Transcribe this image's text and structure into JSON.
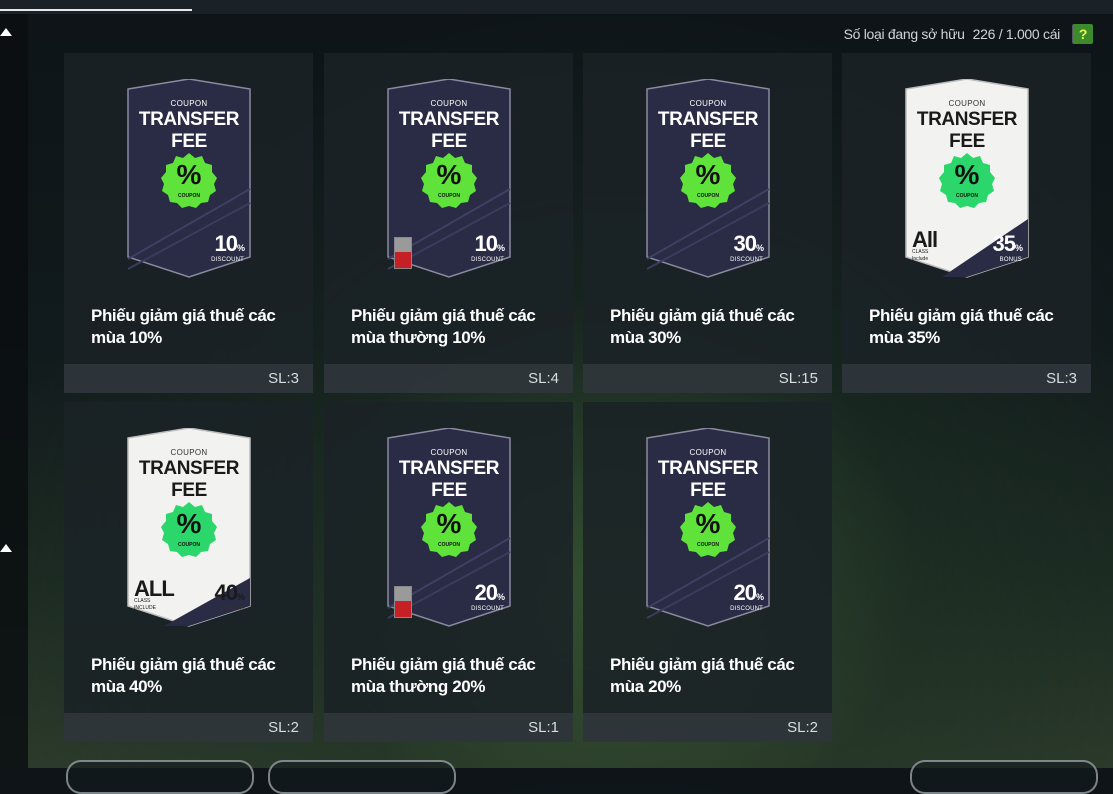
{
  "inventory": {
    "label": "Số loại đang sở hữu",
    "count": "226 / 1.000 cái",
    "help": "?"
  },
  "card_text": {
    "coupon": "COUPON",
    "title": "TRANSFER FEE",
    "pct": "%",
    "badge_coupon": "COUPON",
    "discount": "DISCOUNT",
    "bonus": "BONUS",
    "pct_sign": "%"
  },
  "colors": {
    "badge_green": "#5fe33a",
    "card_dark": "#2a2b44",
    "card_light": "#f2f2f0",
    "help_green": "#3c8a2c"
  },
  "items": [
    {
      "name": "Phiếu giảm giá thuế các mùa 10%",
      "qty": "SL:3",
      "value": "10",
      "sub": "DISCOUNT",
      "style": "dark",
      "locked": false
    },
    {
      "name": "Phiếu giảm giá thuế các mùa thường 10%",
      "qty": "SL:4",
      "value": "10",
      "sub": "DISCOUNT",
      "style": "dark",
      "locked": true
    },
    {
      "name": "Phiếu giảm giá thuế các mùa 30%",
      "qty": "SL:15",
      "value": "30",
      "sub": "DISCOUNT",
      "style": "dark",
      "locked": false
    },
    {
      "name": "Phiếu giảm giá thuế các mùa 35%",
      "qty": "SL:3",
      "value": "35",
      "sub": "BONUS",
      "style": "light",
      "all": "All",
      "all_sub": "CLASS\nInclude",
      "locked": false
    },
    {
      "name": "Phiếu giảm giá thuế các mùa 40%",
      "qty": "SL:2",
      "value": "40",
      "sub": "BONUS",
      "style": "light",
      "all": "ALL",
      "all_sub": "CLASS\nINCLUDE",
      "locked": false
    },
    {
      "name": "Phiếu giảm giá thuế các mùa thường 20%",
      "qty": "SL:1",
      "value": "20",
      "sub": "DISCOUNT",
      "style": "dark",
      "locked": true
    },
    {
      "name": "Phiếu giảm giá thuế các mùa 20%",
      "qty": "SL:2",
      "value": "20",
      "sub": "DISCOUNT",
      "style": "dark",
      "locked": false
    }
  ]
}
